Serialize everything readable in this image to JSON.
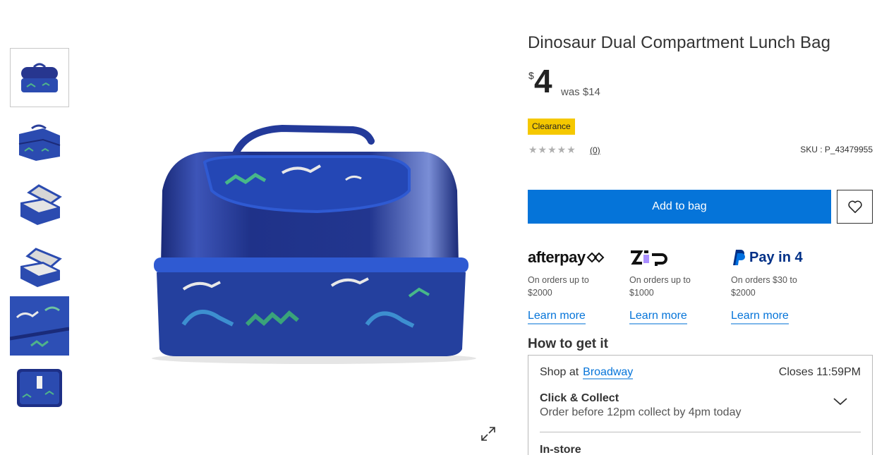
{
  "product": {
    "title": "Dinosaur Dual Compartment Lunch Bag",
    "currency_symbol": "$",
    "price": "4",
    "was_price": "was $14",
    "badge": "Clearance",
    "stars": "★★★★★",
    "reviews": "(0)",
    "sku": "SKU : P_43479955"
  },
  "actions": {
    "add_to_bag": "Add to bag",
    "wishlist_icon": "heart-icon",
    "expand_icon": "expand-icon"
  },
  "payments": [
    {
      "logo_text": "afterpay",
      "note_line1": "On orders up to",
      "note_line2": "$2000",
      "learn": "Learn more"
    },
    {
      "logo_text": "zip",
      "note_line1": "On orders up to",
      "note_line2": "$1000",
      "learn": "Learn more"
    },
    {
      "logo_text": "Pay in 4",
      "note_line1": "On orders $30 to",
      "note_line2": "$2000",
      "learn": "Learn more"
    }
  ],
  "fulfilment": {
    "heading": "How to get it",
    "shop_at": "Shop at",
    "store": "Broadway",
    "closes": "Closes 11:59PM",
    "click_collect_title": "Click & Collect",
    "click_collect_sub": "Order before 12pm collect by 4pm today",
    "instore_title": "In-store"
  },
  "colors": {
    "primary_blue": "#0574d9",
    "badge_yellow": "#f5c800",
    "bag_navy": "#1e3a8a",
    "bag_dark": "#0f1f5c"
  }
}
